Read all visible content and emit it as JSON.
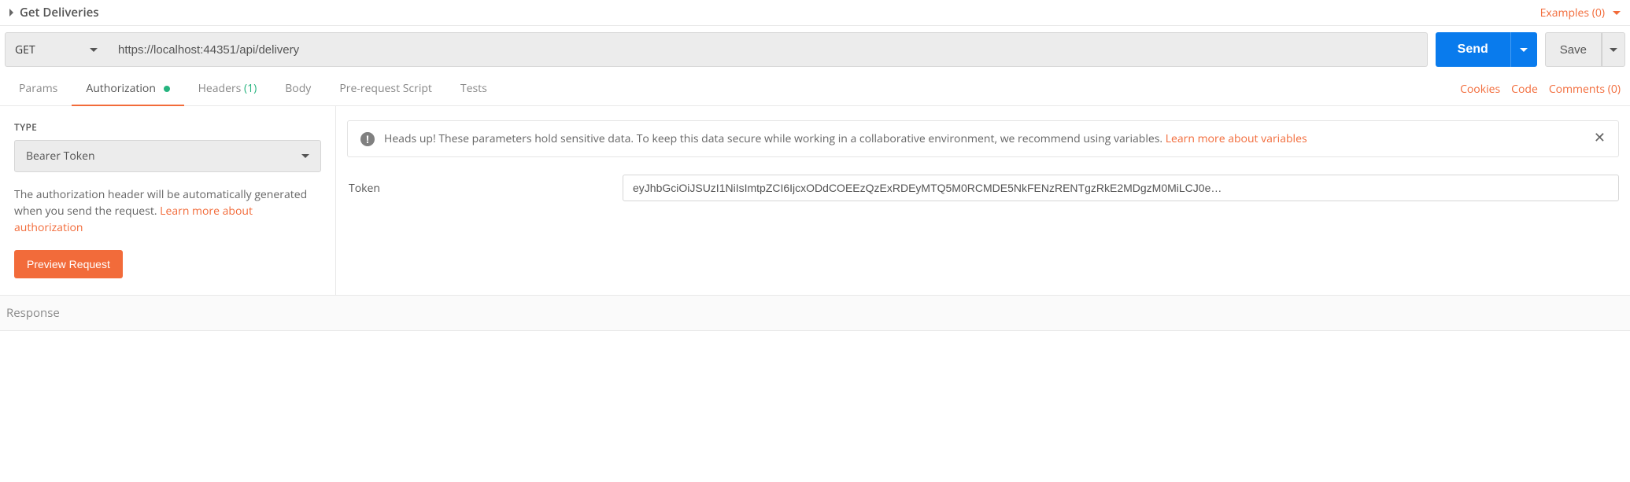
{
  "colors": {
    "accent": "#f26b3a",
    "primary_blue": "#097bed",
    "green": "#26b47f"
  },
  "request": {
    "name": "Get Deliveries",
    "examples_label": "Examples (0)",
    "method": "GET",
    "url": "https://localhost:44351/api/delivery",
    "send_label": "Send",
    "save_label": "Save"
  },
  "tabs": {
    "params": "Params",
    "authorization": "Authorization",
    "headers_prefix": "Headers",
    "headers_count": "(1)",
    "body": "Body",
    "prerequest": "Pre-request Script",
    "tests": "Tests",
    "cookies": "Cookies",
    "code": "Code",
    "comments": "Comments (0)"
  },
  "auth": {
    "type_label": "TYPE",
    "type_selected": "Bearer Token",
    "description_text": "The authorization header will be automatically generated when you send the request. ",
    "description_link": "Learn more about authorization",
    "preview_btn": "Preview Request",
    "notice_prefix": "Heads up!",
    "notice_text": " These parameters hold sensitive data. To keep this data secure while working in a collaborative environment, we recommend using variables. ",
    "notice_link": "Learn more about variables",
    "token_label": "Token",
    "token_value": "eyJhbGciOiJSUzI1NiIsImtpZCI6IjcxODdCOEEzQzExRDEyMTQ5M0RCMDE5NkFENzRENTgzRkE2MDgzM0MiLCJ0e…"
  },
  "response": {
    "label": "Response"
  }
}
